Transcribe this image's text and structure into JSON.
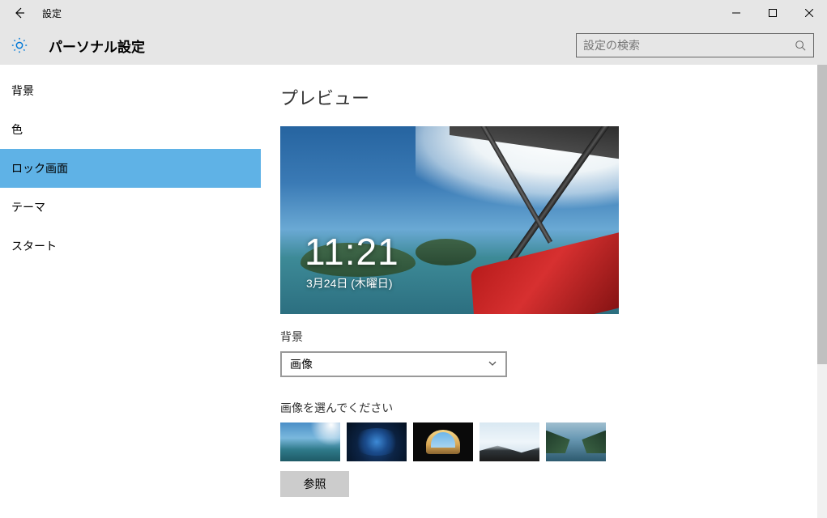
{
  "titlebar": {
    "title": "設定"
  },
  "header": {
    "title": "パーソナル設定",
    "search_placeholder": "設定の検索"
  },
  "sidebar": {
    "items": [
      {
        "label": "背景",
        "selected": false
      },
      {
        "label": "色",
        "selected": false
      },
      {
        "label": "ロック画面",
        "selected": true
      },
      {
        "label": "テーマ",
        "selected": false
      },
      {
        "label": "スタート",
        "selected": false
      }
    ]
  },
  "content": {
    "preview_title": "プレビュー",
    "preview_time": "11:21",
    "preview_date": "3月24日 (木曜日)",
    "background_label": "背景",
    "background_value": "画像",
    "choose_label": "画像を選んでください",
    "browse_label": "参照"
  },
  "thumbnails": [
    {
      "name": "aerial-islands"
    },
    {
      "name": "ice-cave"
    },
    {
      "name": "cave-beach"
    },
    {
      "name": "snow-ridge"
    },
    {
      "name": "fjord-lake"
    }
  ]
}
